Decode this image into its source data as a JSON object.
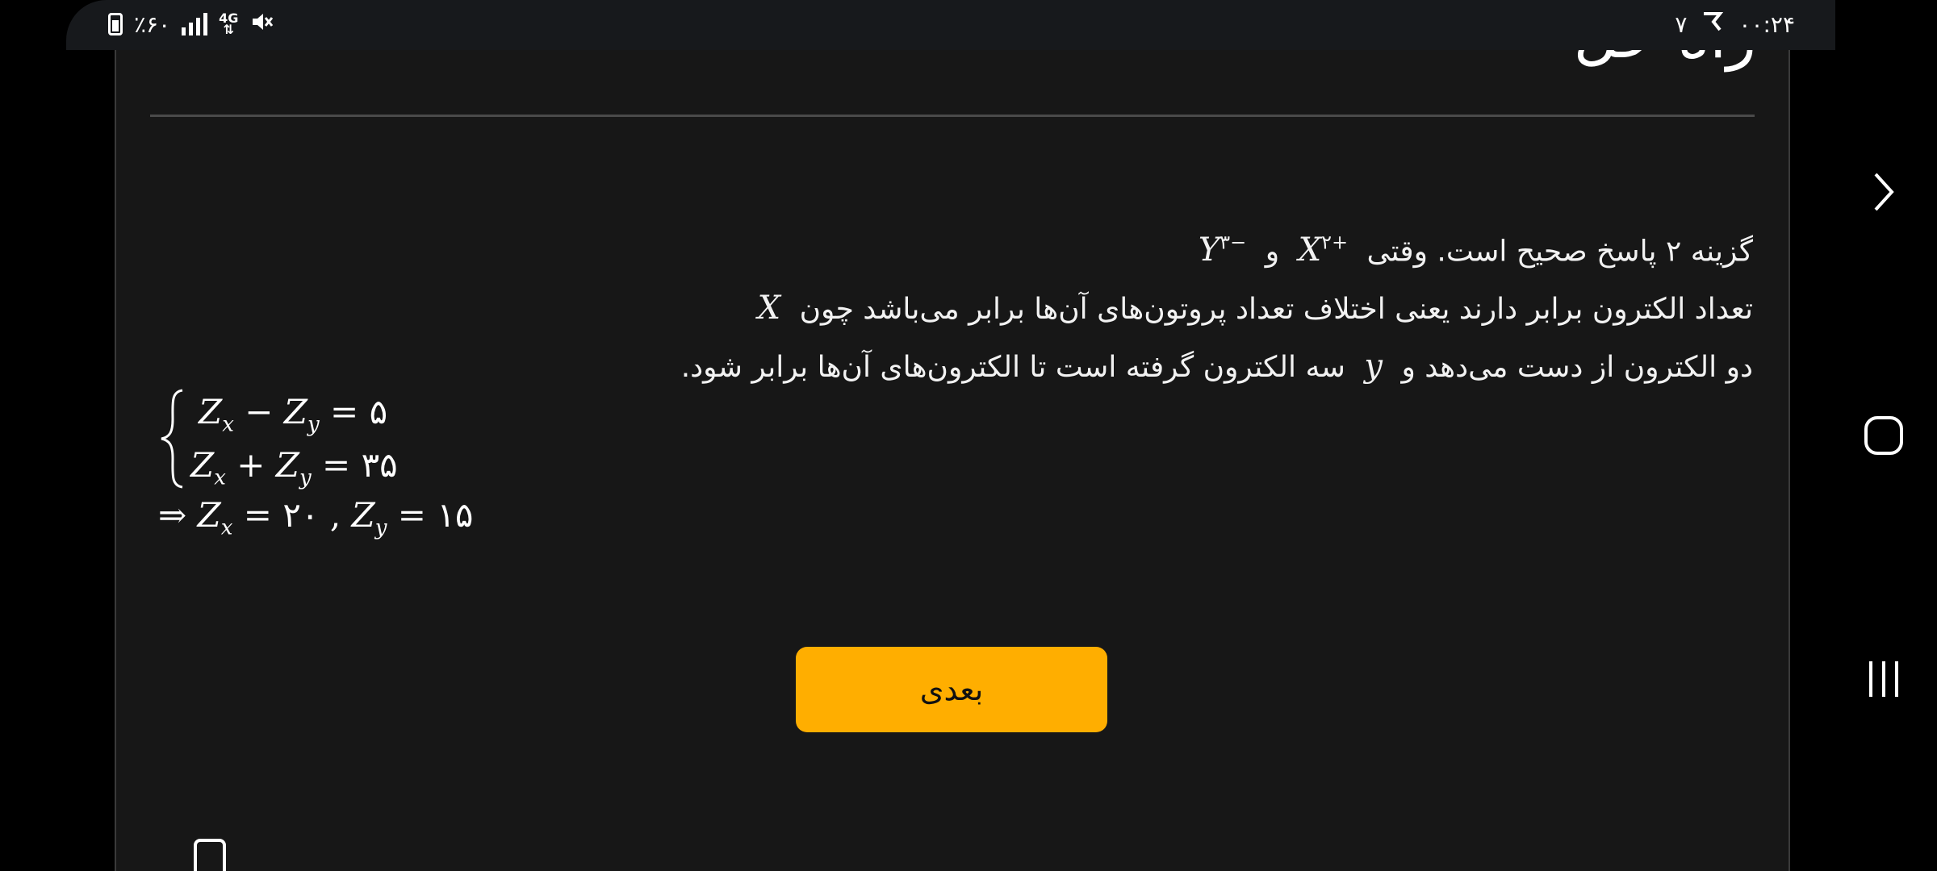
{
  "status_bar": {
    "battery": "٪۶۰",
    "network": "4G",
    "time": "۰۰:۲۴",
    "notification_count": "۷"
  },
  "lesson": {
    "title_fragment": "راه حل",
    "line1": {
      "pre": "گزینه ۲ پاسخ صحیح است. وقتی",
      "m1": "X",
      "m1_sup": "۲+",
      "conj": "و",
      "m2": "Y",
      "m2_sup": "۳−"
    },
    "line2": {
      "pre": "تعداد الکترون برابر دارند یعنی اختلاف تعداد پروتون‌های آن‌ها برابر  می‌باشد چون",
      "m": "X"
    },
    "line3": {
      "pre": "دو الکترون از دست می‌دهد و",
      "m": "y",
      "post": "سه الکترون گرفته است تا الکترون‌های آن‌ها برابر شود."
    },
    "equations": {
      "eq1": {
        "lhs_a": "x",
        "op": "−",
        "lhs_b": "y",
        "rhs": "۵"
      },
      "eq2": {
        "lhs_a": "x",
        "op": "+",
        "lhs_b": "y",
        "rhs": "۳۵"
      },
      "result": {
        "zx": "۲۰",
        "zy": "۱۵"
      }
    }
  },
  "buttons": {
    "next_label": "بعدی"
  },
  "colors": {
    "accent": "#ffae00",
    "card_bg": "#171717",
    "status_bg": "#17191c"
  },
  "nav": {
    "icons": [
      "chevron-right-icon",
      "home-icon",
      "recents-icon"
    ]
  }
}
